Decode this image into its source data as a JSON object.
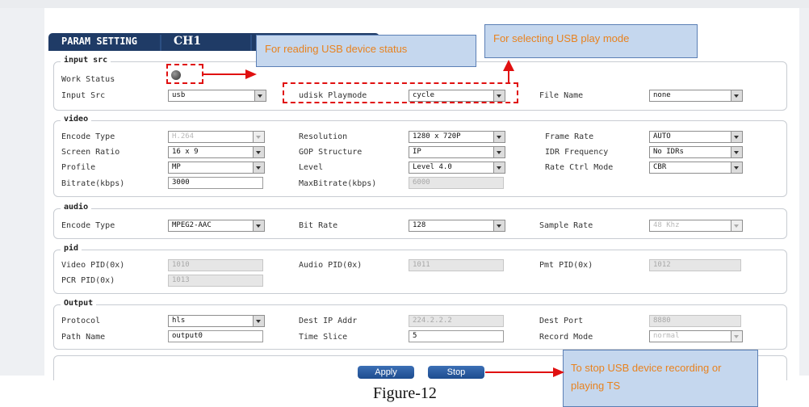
{
  "panel": {
    "title": "PARAM SETTING",
    "channel_tab": "CH1"
  },
  "groups": {
    "input_src": {
      "legend": "input src",
      "work_status_label": "Work Status",
      "input_src_label": "Input Src",
      "input_src_value": "usb",
      "playmode_label": "udisk Playmode",
      "playmode_value": "cycle",
      "file_name_label": "File Name",
      "file_name_value": "none"
    },
    "video": {
      "legend": "video",
      "encode_type_label": "Encode Type",
      "encode_type_value": "H.264",
      "resolution_label": "Resolution",
      "resolution_value": "1280 x 720P",
      "frame_rate_label": "Frame Rate",
      "frame_rate_value": "AUTO",
      "screen_ratio_label": "Screen Ratio",
      "screen_ratio_value": "16 x 9",
      "gop_label": "GOP Structure",
      "gop_value": "IP",
      "idr_label": "IDR Frequency",
      "idr_value": "No IDRs",
      "profile_label": "Profile",
      "profile_value": "MP",
      "level_label": "Level",
      "level_value": "Level 4.0",
      "rate_ctrl_label": "Rate Ctrl Mode",
      "rate_ctrl_value": "CBR",
      "bitrate_label": "Bitrate(kbps)",
      "bitrate_value": "3000",
      "maxbitrate_label": "MaxBitrate(kbps)",
      "maxbitrate_value": "6000"
    },
    "audio": {
      "legend": "audio",
      "encode_type_label": "Encode Type",
      "encode_type_value": "MPEG2-AAC",
      "bit_rate_label": "Bit Rate",
      "bit_rate_value": "128",
      "sample_rate_label": "Sample Rate",
      "sample_rate_value": "48 Khz"
    },
    "pid": {
      "legend": "pid",
      "video_pid_label": "Video PID(0x)",
      "video_pid_value": "1010",
      "audio_pid_label": "Audio PID(0x)",
      "audio_pid_value": "1011",
      "pmt_pid_label": "Pmt PID(0x)",
      "pmt_pid_value": "1012",
      "pcr_pid_label": "PCR PID(0x)",
      "pcr_pid_value": "1013"
    },
    "output": {
      "legend": "Output",
      "protocol_label": "Protocol",
      "protocol_value": "hls",
      "dest_ip_label": "Dest IP Addr",
      "dest_ip_value": "224.2.2.2",
      "dest_port_label": "Dest Port",
      "dest_port_value": "8880",
      "path_name_label": "Path Name",
      "path_name_value": "output0",
      "time_slice_label": "Time Slice",
      "time_slice_value": "5",
      "record_mode_label": "Record Mode",
      "record_mode_value": "normal"
    }
  },
  "buttons": {
    "apply": "Apply",
    "stop": "Stop"
  },
  "annotations": {
    "usb_status": "For reading USB device status",
    "usb_playmode": "For selecting USB play mode",
    "stop_note": "To stop USB device recording or playing TS"
  },
  "caption": "Figure-12",
  "colors": {
    "header": "#1f3b66",
    "callout_bg": "#c5d7ee",
    "callout_text": "#e8821e",
    "marker": "#e01010",
    "button": "#2a5ca3"
  }
}
